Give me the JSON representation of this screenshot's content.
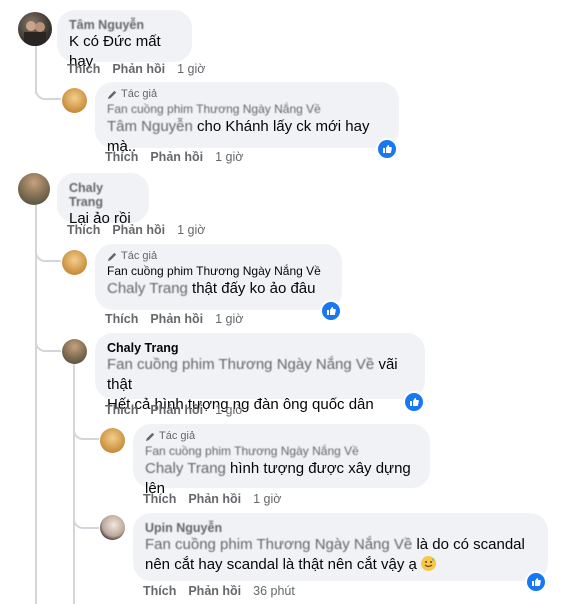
{
  "labels": {
    "like": "Thích",
    "reply": "Phản hồi",
    "author_tag": "Tác giả"
  },
  "comments": [
    {
      "author": "Tâm Nguyễn",
      "text": "K có Đức mất hay",
      "time": "1 giờ"
    },
    {
      "author": "Fan cuồng phim Thương Ngày Nắng Về",
      "mention": "Tâm Nguyễn",
      "text": "cho Khánh lấy ck mới hay mà..",
      "time": "1 giờ"
    },
    {
      "author": "Chaly Trang",
      "text": "Lại ảo rồi",
      "time": "1 giờ"
    },
    {
      "author": "Fan cuồng phim Thương Ngày Nắng Về",
      "mention": "Chaly Trang",
      "text": "thật đấy ko ảo đâu",
      "time": "1 giờ"
    },
    {
      "author": "Chaly Trang",
      "mention": "Fan cuồng phim Thương Ngày Nắng Về",
      "text_a": "vãi thật",
      "text_b": "Hết cả hình tượng ng đàn ông quốc dân",
      "time": "1 giờ"
    },
    {
      "author": "Fan cuồng phim Thương Ngày Nắng Về",
      "mention": "Chaly Trang",
      "text": "hình tượng được xây dựng lên",
      "time": "1 giờ"
    },
    {
      "author": "Upin Nguyễn",
      "mention": "Fan cuồng phim Thương Ngày Nắng Về",
      "text_a": "là do có scandal",
      "text_b": "nên cắt hay scandal là thật nên cắt vậy ạ",
      "time": "36 phút"
    }
  ],
  "colors": {
    "like_blue": "#1877f2",
    "bubble": "#f0f2f5",
    "thread_line": "#d3d6db"
  }
}
